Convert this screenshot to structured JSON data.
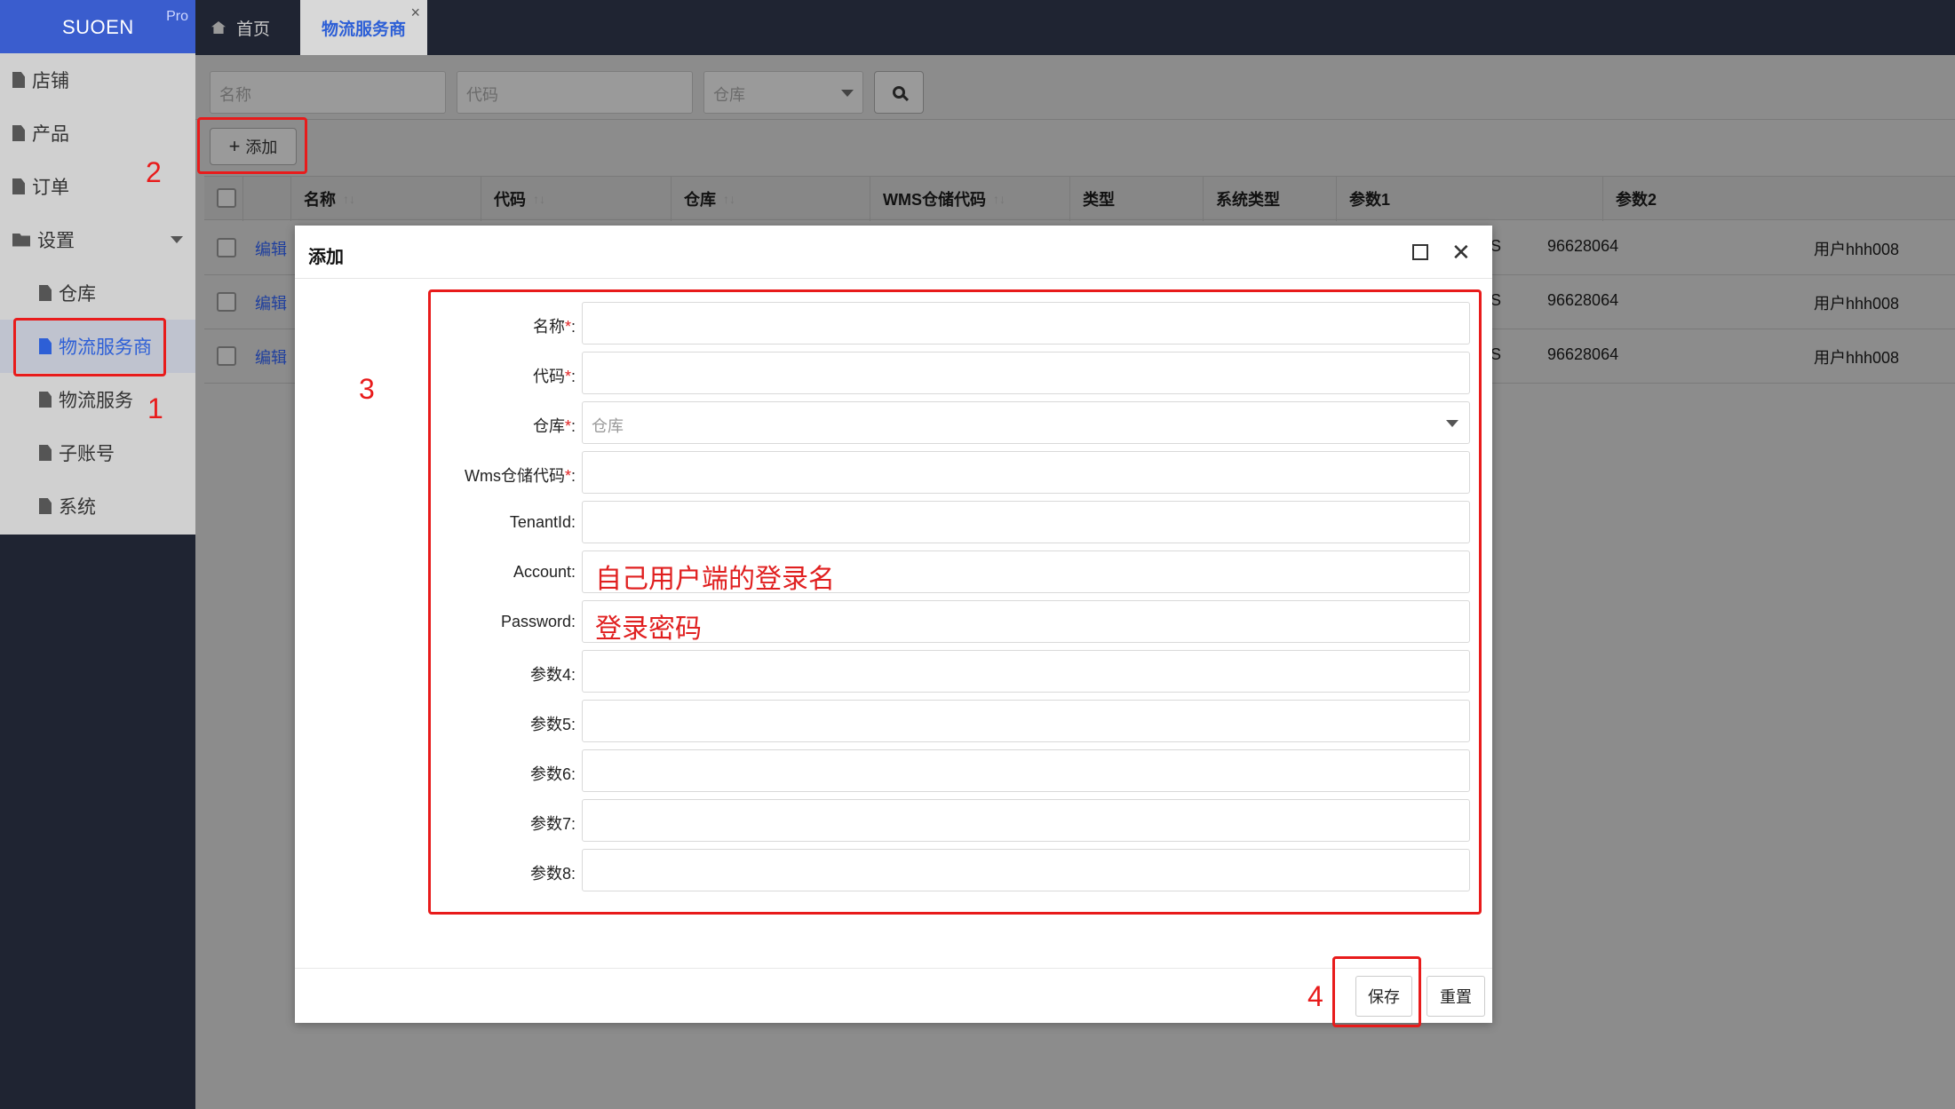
{
  "brand": {
    "name": "SUOEN",
    "badge": "Pro"
  },
  "sidebar": {
    "items": [
      {
        "label": "店铺"
      },
      {
        "label": "产品"
      },
      {
        "label": "订单"
      },
      {
        "label": "设置"
      },
      {
        "label": "仓库"
      },
      {
        "label": "物流服务商"
      },
      {
        "label": "物流服务"
      },
      {
        "label": "子账号"
      },
      {
        "label": "系统"
      }
    ]
  },
  "tabs": {
    "home": "首页",
    "active": "物流服务商",
    "close": "×"
  },
  "filters": {
    "name_placeholder": "名称",
    "code_placeholder": "代码",
    "warehouse_placeholder": "仓库"
  },
  "toolbar": {
    "add_label": "添加",
    "add_plus": "+"
  },
  "table": {
    "headers": [
      "名称",
      "代码",
      "仓库",
      "WMS仓储代码",
      "类型",
      "系统类型",
      "参数1",
      "参数2"
    ],
    "sort_glyph": "↑↓",
    "rows": [
      {
        "edit": "编辑",
        "sys_partial": "S",
        "param1": "96628064",
        "param2": "用户hhh008"
      },
      {
        "edit": "编辑",
        "sys_partial": "S",
        "param1": "96628064",
        "param2": "用户hhh008"
      },
      {
        "edit": "编辑",
        "sys_partial": "S",
        "param1": "96628064",
        "param2": "用户hhh008"
      }
    ]
  },
  "modal": {
    "title": "添加",
    "fields": [
      {
        "label": "名称",
        "required": "*",
        "colon": ":"
      },
      {
        "label": "代码",
        "required": "*",
        "colon": ":"
      },
      {
        "label": "仓库",
        "required": "*",
        "colon": ":",
        "placeholder": "仓库"
      },
      {
        "label": "Wms仓储代码",
        "required": "*",
        "colon": ":"
      },
      {
        "label": "TenantId",
        "colon": ":"
      },
      {
        "label": "Account",
        "colon": ":",
        "hint": "自己用户端的登录名"
      },
      {
        "label": "Password",
        "colon": ":",
        "hint": "登录密码"
      },
      {
        "label": "参数4",
        "colon": ":"
      },
      {
        "label": "参数5",
        "colon": ":"
      },
      {
        "label": "参数6",
        "colon": ":"
      },
      {
        "label": "参数7",
        "colon": ":"
      },
      {
        "label": "参数8",
        "colon": ":"
      }
    ],
    "save_label": "保存",
    "reset_label": "重置"
  },
  "annotations": {
    "n1": "1",
    "n2": "2",
    "n3": "3",
    "n4": "4",
    "color": "#e81b1b"
  }
}
